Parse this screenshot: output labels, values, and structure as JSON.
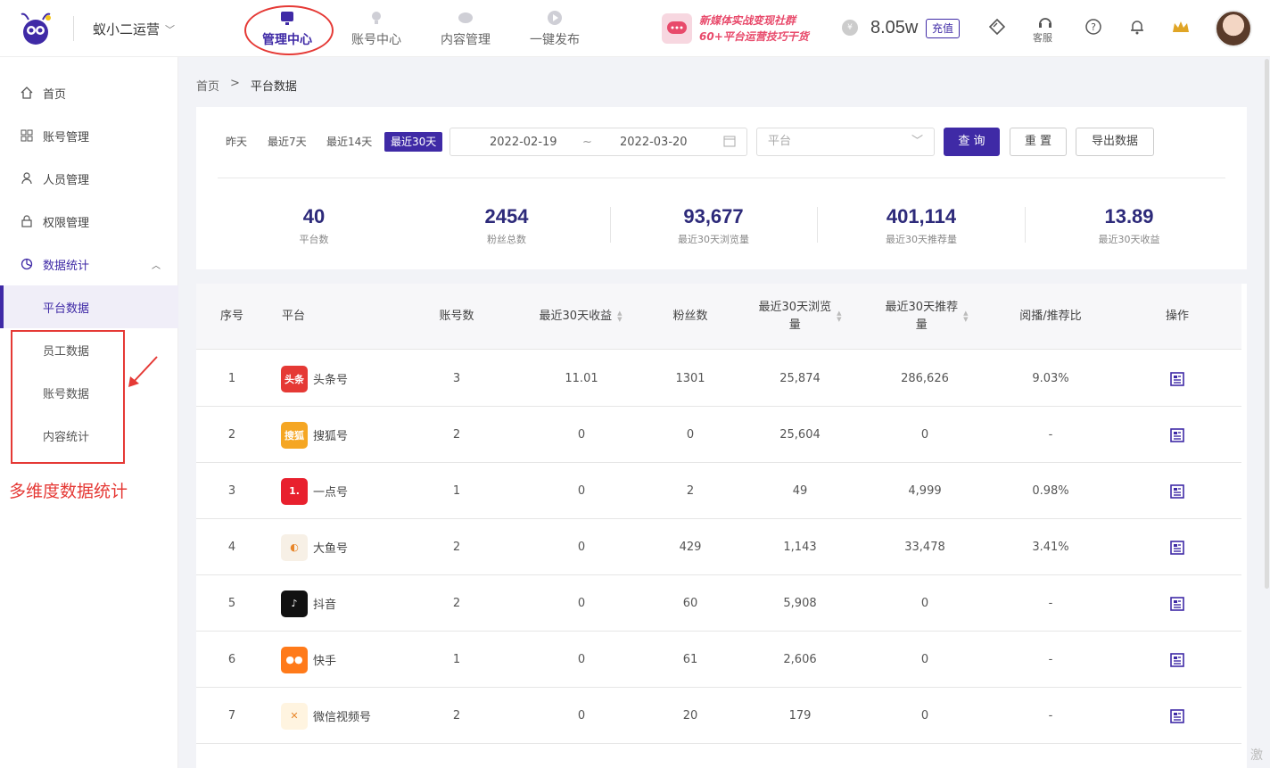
{
  "header": {
    "org_name": "蚁小二运营",
    "nav": [
      {
        "label": "管理中心",
        "icon": "monitor-icon",
        "active": true
      },
      {
        "label": "账号中心",
        "icon": "lightbulb-icon",
        "active": false
      },
      {
        "label": "内容管理",
        "icon": "chat-icon",
        "active": false
      },
      {
        "label": "一键发布",
        "icon": "play-icon",
        "active": false
      }
    ],
    "promo_line1": "新媒体实战变现社群",
    "promo_line2": "60+平台运营技巧干货",
    "balance": "8.05w",
    "recharge_label": "充值",
    "service_label": "客服"
  },
  "sidebar": {
    "items": [
      {
        "label": "首页",
        "icon": "home-icon"
      },
      {
        "label": "账号管理",
        "icon": "grid-icon"
      },
      {
        "label": "人员管理",
        "icon": "user-icon"
      },
      {
        "label": "权限管理",
        "icon": "lock-icon"
      },
      {
        "label": "数据统计",
        "icon": "pie-chart-icon"
      }
    ],
    "sub_items": [
      {
        "label": "平台数据",
        "active": true
      },
      {
        "label": "员工数据",
        "active": false
      },
      {
        "label": "账号数据",
        "active": false
      },
      {
        "label": "内容统计",
        "active": false
      }
    ],
    "annotation": "多维度数据统计"
  },
  "breadcrumb": {
    "home": "首页",
    "sep": ">",
    "current": "平台数据"
  },
  "filters": {
    "ranges": [
      "昨天",
      "最近7天",
      "最近14天",
      "最近30天"
    ],
    "active_range": "最近30天",
    "date_start": "2022-02-19",
    "date_sep": "~",
    "date_end": "2022-03-20",
    "platform_placeholder": "平台",
    "query_label": "查 询",
    "reset_label": "重 置",
    "export_label": "导出数据"
  },
  "stats": [
    {
      "value": "40",
      "label": "平台数"
    },
    {
      "value": "2454",
      "label": "粉丝总数"
    },
    {
      "value": "93,677",
      "label": "最近30天浏览量"
    },
    {
      "value": "401,114",
      "label": "最近30天推荐量"
    },
    {
      "value": "13.89",
      "label": "最近30天收益"
    }
  ],
  "table": {
    "headers": {
      "index": "序号",
      "platform": "平台",
      "accounts": "账号数",
      "income": "最近30天收益",
      "fans": "粉丝数",
      "views_1": "最近30天浏览",
      "views_2": "量",
      "recs_1": "最近30天推荐",
      "recs_2": "量",
      "ratio": "阅播/推荐比",
      "ops": "操作"
    },
    "rows": [
      {
        "index": "1",
        "platform": "头条号",
        "accounts": "3",
        "income": "11.01",
        "fans": "1301",
        "views": "25,874",
        "recs": "286,626",
        "ratio": "9.03%",
        "logo_text": "头条",
        "logo_color": "#e53935"
      },
      {
        "index": "2",
        "platform": "搜狐号",
        "accounts": "2",
        "income": "0",
        "fans": "0",
        "views": "25,604",
        "recs": "0",
        "ratio": "-",
        "logo_text": "搜狐",
        "logo_color": "#f5a623"
      },
      {
        "index": "3",
        "platform": "一点号",
        "accounts": "1",
        "income": "0",
        "fans": "2",
        "views": "49",
        "recs": "4,999",
        "ratio": "0.98%",
        "logo_text": "1.",
        "logo_color": "#e8202e"
      },
      {
        "index": "4",
        "platform": "大鱼号",
        "accounts": "2",
        "income": "0",
        "fans": "429",
        "views": "1,143",
        "recs": "33,478",
        "ratio": "3.41%",
        "logo_text": "◐",
        "logo_color": "#f7f0e6"
      },
      {
        "index": "5",
        "platform": "抖音",
        "accounts": "2",
        "income": "0",
        "fans": "60",
        "views": "5,908",
        "recs": "0",
        "ratio": "-",
        "logo_text": "♪",
        "logo_color": "#111111"
      },
      {
        "index": "6",
        "platform": "快手",
        "accounts": "1",
        "income": "0",
        "fans": "61",
        "views": "2,606",
        "recs": "0",
        "ratio": "-",
        "logo_text": "●●",
        "logo_color": "#ff7a1a"
      },
      {
        "index": "7",
        "platform": "微信视频号",
        "accounts": "2",
        "income": "0",
        "fans": "20",
        "views": "179",
        "recs": "0",
        "ratio": "-",
        "logo_text": "✕",
        "logo_color": "#fff4e0"
      }
    ]
  },
  "watermark": "激"
}
